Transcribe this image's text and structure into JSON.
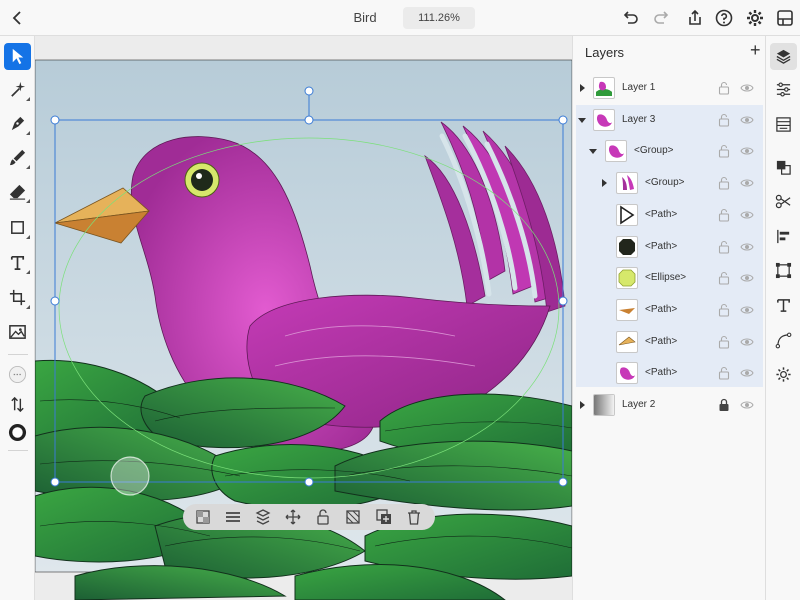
{
  "document": {
    "title": "Bird",
    "zoom": "111.26%"
  },
  "topbar": {
    "back_icon": "chevron-left-icon",
    "undo_icon": "undo-icon",
    "redo_icon": "redo-icon",
    "share_icon": "share-icon",
    "help_icon": "help-icon",
    "settings_icon": "gear-icon",
    "export_icon": "export-icon"
  },
  "tools": [
    {
      "name": "selection",
      "icon": "arrow-pointer-icon",
      "active": true
    },
    {
      "name": "direct-selection",
      "icon": "magic-wand-icon",
      "active": false
    },
    {
      "name": "pen",
      "icon": "pen-icon",
      "active": false
    },
    {
      "name": "brush",
      "icon": "brush-icon",
      "active": false
    },
    {
      "name": "eraser",
      "icon": "eraser-icon",
      "active": false
    },
    {
      "name": "shape",
      "icon": "rectangle-icon",
      "active": false
    },
    {
      "name": "type",
      "icon": "type-icon",
      "active": false
    },
    {
      "name": "crop",
      "icon": "crop-icon",
      "active": false
    },
    {
      "name": "image",
      "icon": "image-icon",
      "active": false
    },
    {
      "name": "more",
      "icon": "more-icon",
      "active": false
    },
    {
      "name": "swap",
      "icon": "swap-icon",
      "active": false
    },
    {
      "name": "fill-stroke",
      "icon": "stroke-color-icon",
      "active": false
    }
  ],
  "context_toolbar": [
    "transparency-icon",
    "align-icon",
    "arrange-icon",
    "move-icon",
    "lock-icon",
    "mask-icon",
    "duplicate-icon",
    "trash-icon"
  ],
  "layers_panel": {
    "title": "Layers",
    "add_label": "+",
    "rows": [
      {
        "name": "Layer 1",
        "expanded": false,
        "selected": false,
        "locked": false,
        "visible": true
      },
      {
        "name": "Layer 3",
        "expanded": true,
        "selected": true,
        "locked": false,
        "visible": true
      },
      {
        "name": "<Group>",
        "expanded": true,
        "selected": true,
        "locked": false,
        "visible": true
      },
      {
        "name": "<Group>",
        "expanded": false,
        "selected": true,
        "locked": false,
        "visible": true
      },
      {
        "name": "<Path>",
        "selected": true,
        "locked": false,
        "visible": true
      },
      {
        "name": "<Path>",
        "selected": true,
        "locked": false,
        "visible": true
      },
      {
        "name": "<Ellipse>",
        "selected": true,
        "locked": false,
        "visible": true
      },
      {
        "name": "<Path>",
        "selected": true,
        "locked": false,
        "visible": true
      },
      {
        "name": "<Path>",
        "selected": true,
        "locked": false,
        "visible": true
      },
      {
        "name": "<Path>",
        "selected": true,
        "locked": false,
        "visible": true
      },
      {
        "name": "Layer 2",
        "expanded": false,
        "selected": false,
        "locked": true,
        "visible": true
      }
    ]
  },
  "right_rail": [
    "layers-icon",
    "properties-icon",
    "appearance-icon",
    "pathfinder-icon",
    "scissors-icon",
    "align-icon",
    "transform-icon",
    "type-icon",
    "curvature-icon",
    "settings-icon"
  ],
  "colors": {
    "accent": "#1473e6",
    "bird": "#c738b8",
    "leaf": "#2f9a3a",
    "sky": "#c8d9e2",
    "beak": "#e6b25a"
  }
}
